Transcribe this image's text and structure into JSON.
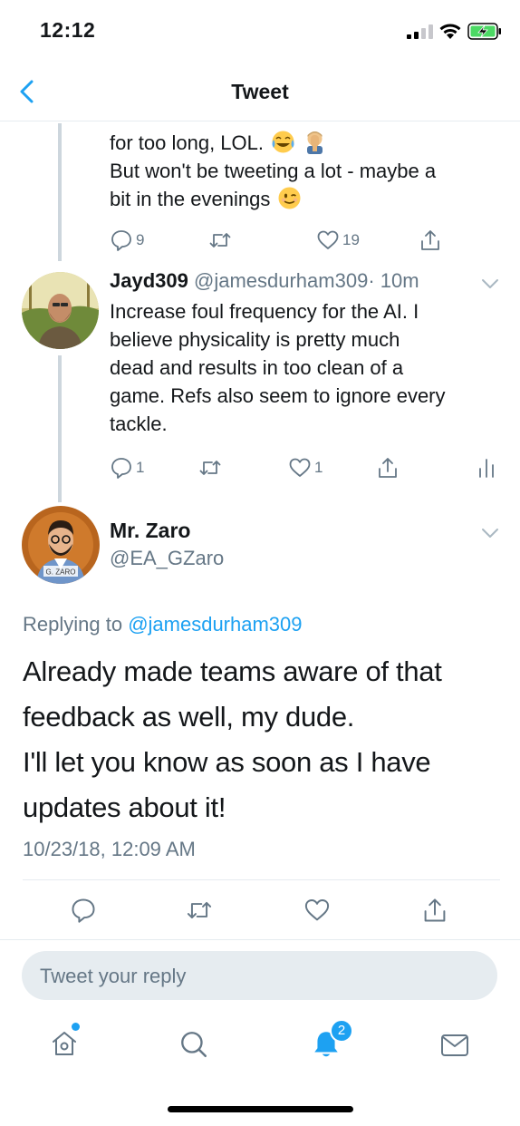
{
  "status_bar": {
    "time": "12:12"
  },
  "nav": {
    "title": "Tweet"
  },
  "tweet1": {
    "lines": [
      "for too long, LOL.",
      "But won't be tweeting a lot - maybe a",
      "bit in the evenings"
    ],
    "reply_count": "9",
    "like_count": "19"
  },
  "tweet2": {
    "name": "Jayd309",
    "handle": "@jamesdurham309",
    "time": "· 10m",
    "lines": [
      "Increase foul frequency for the AI. I",
      "believe physicality is pretty much",
      "dead and results in too clean of a",
      "game. Refs also seem to ignore every",
      "tackle."
    ],
    "reply_count": "1",
    "like_count": "1"
  },
  "main_tweet": {
    "name": "Mr. Zaro",
    "handle": "@EA_GZaro",
    "avatar_caption": "G. ZARO",
    "replying_prefix": "Replying to ",
    "replying_handle": "@jamesdurham309",
    "lines": [
      "Already made teams aware of that",
      "feedback as well, my dude.",
      "I'll let you know as soon as I have",
      "updates about it!"
    ],
    "timestamp": "10/23/18, 12:09 AM"
  },
  "reply_box": {
    "placeholder": "Tweet your reply"
  },
  "tab_bar": {
    "notification_badge": "2"
  },
  "colors": {
    "accent": "#1da1f2",
    "secondary_text": "#657786",
    "primary_text": "#14171a",
    "divider": "#e6ecf0"
  }
}
